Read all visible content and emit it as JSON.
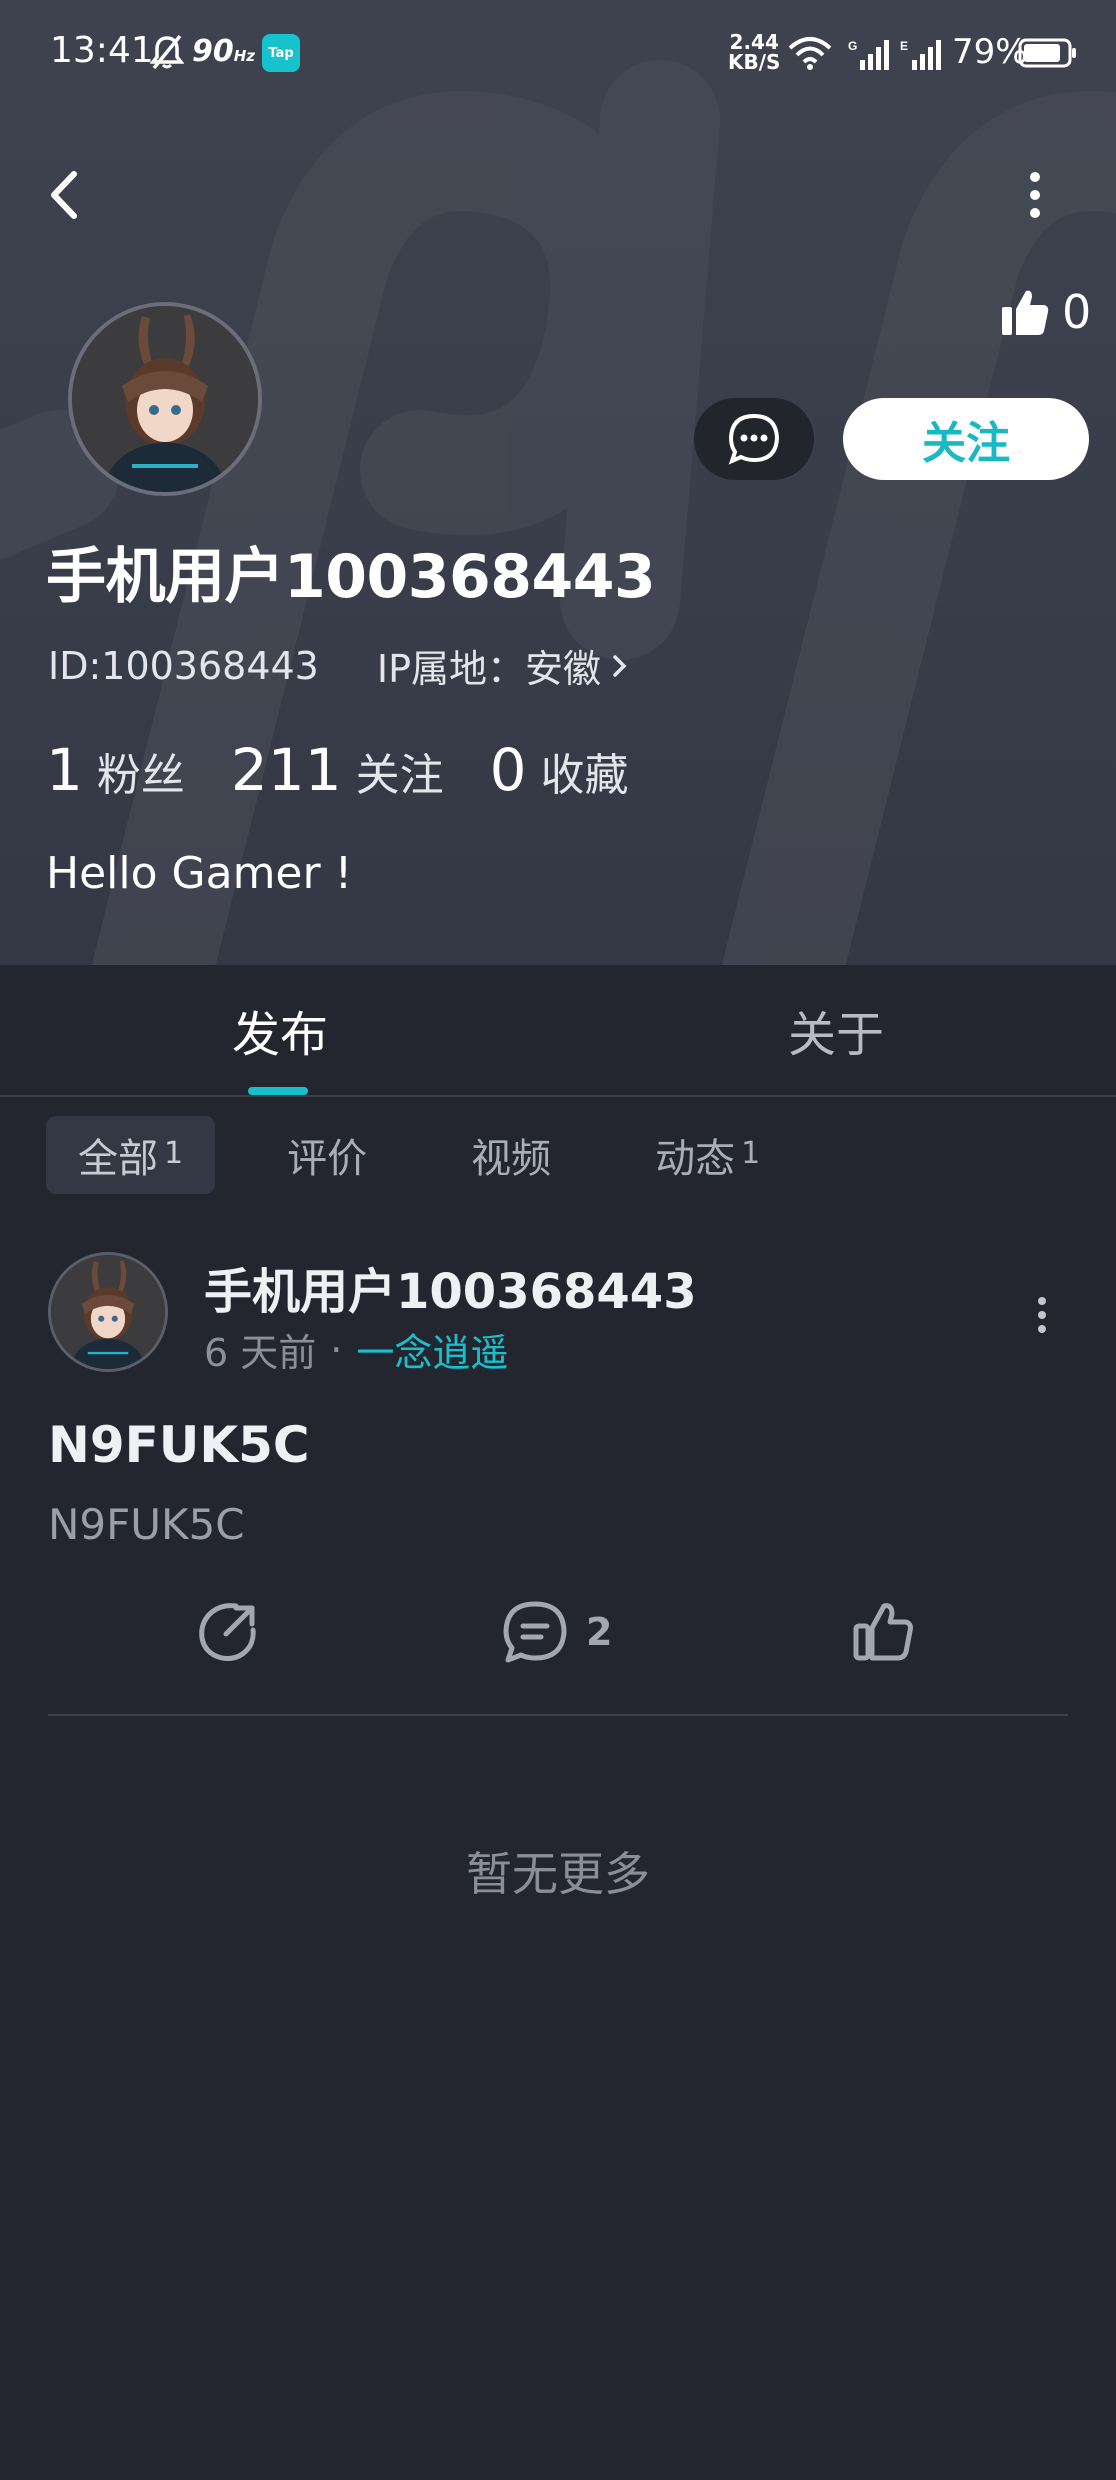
{
  "status_bar": {
    "time": "13:41",
    "refresh_rate": "90",
    "refresh_unit": "Hz",
    "tap_badge": "Tap",
    "net_speed_value": "2.44",
    "net_speed_unit": "KB/S",
    "battery_percent": "79%"
  },
  "profile": {
    "like_count": "0",
    "follow_label": "关注",
    "username": "手机用户100368443",
    "id_text": "ID:100368443",
    "ip_text": "IP属地：安徽",
    "stats": [
      {
        "num": "1",
        "label": "粉丝"
      },
      {
        "num": "211",
        "label": "关注"
      },
      {
        "num": "0",
        "label": "收藏"
      }
    ],
    "bio": "Hello Gamer !"
  },
  "tabs": [
    {
      "label": "发布",
      "active": true
    },
    {
      "label": "关于",
      "active": false
    }
  ],
  "filters": [
    {
      "label": "全部",
      "count": "1",
      "active": true
    },
    {
      "label": "评价",
      "count": ""
    },
    {
      "label": "视频",
      "count": ""
    },
    {
      "label": "动态",
      "count": "1"
    }
  ],
  "post": {
    "author": "手机用户100368443",
    "time": "6 天前",
    "separator": "·",
    "game": "一念逍遥",
    "title": "N9FUK5C",
    "body": "N9FUK5C",
    "comment_count": "2"
  },
  "footer": {
    "no_more": "暂无更多"
  },
  "colors": {
    "accent": "#19c0cc",
    "background": "#23252f",
    "header": "#3f434f"
  },
  "icons": {
    "back": "back-icon",
    "more": "more-vertical-icon",
    "like": "thumbs-up-icon",
    "message": "chat-bubble-icon",
    "share": "share-icon",
    "comment": "comment-icon"
  }
}
